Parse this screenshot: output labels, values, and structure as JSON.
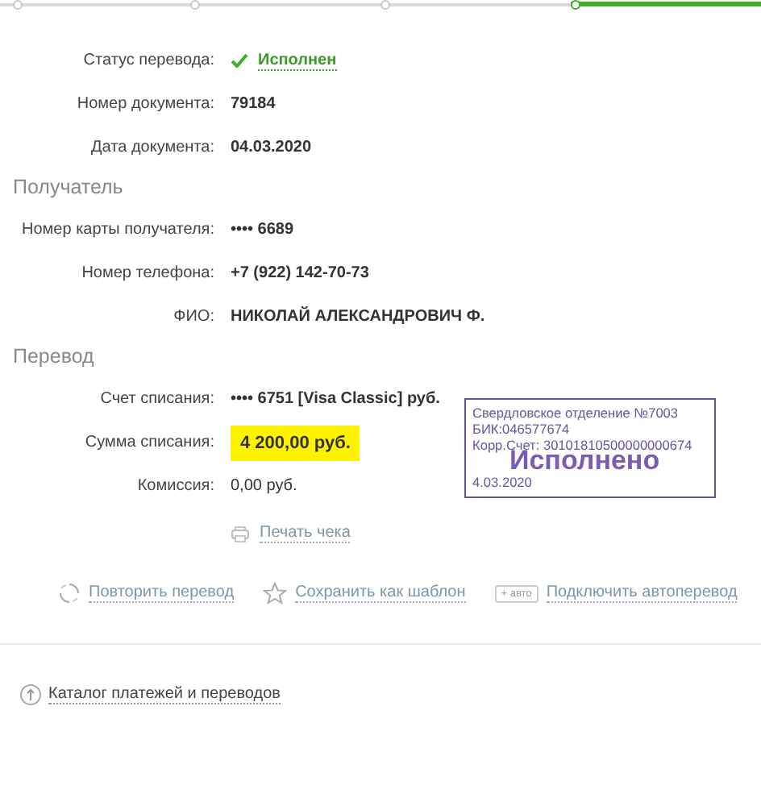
{
  "progress_steps": [
    {
      "selected": false
    },
    {
      "selected": false
    },
    {
      "selected": false
    },
    {
      "selected": true
    }
  ],
  "sections": [
    {
      "rows": [
        {
          "label": "Статус перевода:",
          "value": "Исполнен",
          "kind": "status"
        },
        {
          "label": "Номер документа:",
          "value": "79184",
          "kind": "bold"
        },
        {
          "label": "Дата документа:",
          "value": "04.03.2020",
          "kind": "bold"
        }
      ]
    },
    {
      "title": "Получатель",
      "rows": [
        {
          "label": "Номер карты получателя:",
          "value": "•••• 6689",
          "kind": "bold"
        },
        {
          "label": "Номер телефона:",
          "value": "+7 (922) 142-70-73",
          "kind": "bold"
        },
        {
          "label": "ФИО:",
          "value": "НИКОЛАЙ АЛЕКСАНДРОВИЧ Ф.",
          "kind": "bold"
        }
      ]
    },
    {
      "title": "Перевод",
      "rows": [
        {
          "label": "Счет списания:",
          "value": "•••• 6751  [Visa Classic]  руб.",
          "kind": "bold"
        },
        {
          "label": "Сумма списания:",
          "value": "4 200,00  руб.",
          "kind": "highlight"
        },
        {
          "label": "Комиссия:",
          "value": "0,00 руб.",
          "kind": "plain"
        }
      ]
    }
  ],
  "stamp": {
    "lines": [
      "Свердловское отделение №7003",
      "БИК:046577674",
      "Корр.Счет: 30101810500000000674"
    ],
    "title": "Исполнено",
    "date": "4.03.2020"
  },
  "print_link": "Печать чека",
  "actions": [
    {
      "kind": "repeat",
      "label": "Повторить перевод"
    },
    {
      "kind": "star",
      "label": "Сохранить как шаблон"
    },
    {
      "kind": "auto",
      "badge": "+ авто",
      "label": "Подключить автоперевод"
    }
  ],
  "catalog_link": "Каталог платежей и переводов"
}
